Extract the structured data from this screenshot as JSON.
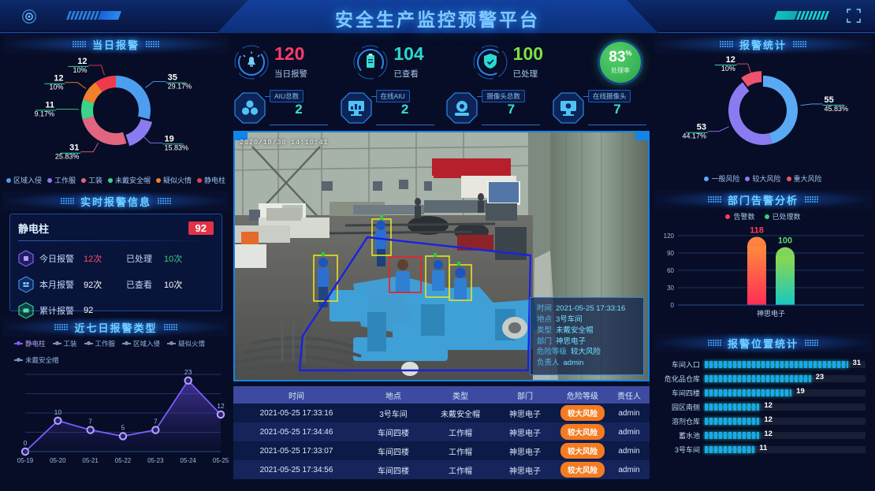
{
  "header": {
    "title": "安全生产监控预警平台",
    "gear_icon": "gear-icon",
    "fullscreen_icon": "fullscreen-icon"
  },
  "left": {
    "daily_alarm": {
      "title": "当日报警",
      "chart_data": {
        "type": "pie",
        "title": "当日报警",
        "categories": [
          "区域入侵",
          "工作服",
          "工装",
          "未戴安全帽",
          "疑似火情",
          "静电柱"
        ],
        "values": [
          35,
          19,
          31,
          11,
          12,
          12
        ],
        "percents": [
          "29.17%",
          "15.83%",
          "25.83%",
          "9.17%",
          "10%",
          "10%"
        ],
        "colors": [
          "#4d9ef0",
          "#8a7bf0",
          "#e2657f",
          "#3cd48a",
          "#f0802e",
          "#ee3b4b"
        ],
        "legend_position": "bottom"
      }
    },
    "realtime": {
      "title": "实时报警信息",
      "name": "静电柱",
      "badge": "92",
      "rows": [
        {
          "icon": "alarm-hex-icon",
          "label": "今日报警",
          "value": "12次",
          "label2": "已处理",
          "value2": "10次"
        },
        {
          "icon": "calendar-hex-icon",
          "label": "本月报警",
          "value": "92次",
          "label2": "已查看",
          "value2": "10次"
        },
        {
          "icon": "total-hex-icon",
          "label": "累计报警",
          "value": "92",
          "label2": "",
          "value2": ""
        }
      ]
    },
    "seven_day": {
      "title": "近七日报警类型",
      "legend": [
        "静电柱",
        "工装",
        "工作服",
        "区域入侵",
        "疑似火情",
        "未戴安全帽"
      ],
      "chart_data": {
        "type": "line",
        "title": "近七日报警类型",
        "categories": [
          "05-19",
          "05-20",
          "05-21",
          "05-22",
          "05-23",
          "05-24",
          "05-25"
        ],
        "series": [
          {
            "name": "静电柱",
            "values": [
              0,
              10,
              7,
              5,
              7,
              23,
              12
            ],
            "color": "#7c5cff"
          }
        ],
        "ylim": [
          0,
          25
        ],
        "grid": true
      }
    }
  },
  "center": {
    "stats": [
      {
        "icon": "alarm-bell-icon",
        "value": "120",
        "label": "当日报警",
        "color": "#ff3b6b"
      },
      {
        "icon": "clipboard-icon",
        "value": "104",
        "label": "已查看",
        "color": "#2ad9d0"
      },
      {
        "icon": "shield-check-icon",
        "value": "100",
        "label": "已处理",
        "color": "#7ee043"
      }
    ],
    "rate": {
      "value": "83",
      "unit": "%",
      "label": "处理率",
      "color": "#3cc45f"
    },
    "devices": [
      {
        "icon": "cube-icon",
        "caption": "AIU总数",
        "value": "2"
      },
      {
        "icon": "monitor-aiu-icon",
        "caption": "在线AIU",
        "value": "2"
      },
      {
        "icon": "camera-icon",
        "caption": "摄像头总数",
        "value": "7"
      },
      {
        "icon": "monitor-camera-icon",
        "caption": "在线摄像头",
        "value": "7"
      }
    ],
    "video": {
      "timestamp": "2020/10/30    14:10:41",
      "overlay": {
        "rows": [
          {
            "key": "时间",
            "value": "2021-05-25 17:33:16"
          },
          {
            "key": "地点",
            "value": "3号车间"
          },
          {
            "key": "类型",
            "value": "未戴安全帽"
          },
          {
            "key": "部门",
            "value": "神思电子"
          },
          {
            "key": "危险等级",
            "value": "较大风险"
          },
          {
            "key": "负责人",
            "value": "admin"
          }
        ]
      }
    },
    "table": {
      "columns": [
        "时间",
        "地点",
        "类型",
        "部门",
        "危险等级",
        "责任人"
      ],
      "rows": [
        {
          "time": "2021-05-25 17:33:16",
          "place": "3号车间",
          "type": "未戴安全帽",
          "dept": "神思电子",
          "risk": "较大风险",
          "owner": "admin"
        },
        {
          "time": "2021-05-25 17:34:46",
          "place": "车间四楼",
          "type": "工作帽",
          "dept": "神思电子",
          "risk": "较大风险",
          "owner": "admin"
        },
        {
          "time": "2021-05-25 17:33:07",
          "place": "车间四楼",
          "type": "工作帽",
          "dept": "神思电子",
          "risk": "较大风险",
          "owner": "admin"
        },
        {
          "time": "2021-05-25 17:34:56",
          "place": "车间四楼",
          "type": "工作帽",
          "dept": "神思电子",
          "risk": "较大风险",
          "owner": "admin"
        }
      ]
    }
  },
  "right": {
    "alarm_stat": {
      "title": "报警统计",
      "chart_data": {
        "type": "pie",
        "title": "报警统计",
        "categories": [
          "一般风险",
          "较大风险",
          "重大风险"
        ],
        "values": [
          55,
          53,
          12
        ],
        "percents": [
          "45.83%",
          "44.17%",
          "10%"
        ],
        "colors": [
          "#5aa9f5",
          "#8a7bf0",
          "#f0526e"
        ],
        "legend_position": "bottom"
      }
    },
    "dept": {
      "title": "部门告警分析",
      "chart_data": {
        "type": "bar",
        "title": "部门告警分析",
        "categories": [
          "神思电子"
        ],
        "series": [
          {
            "name": "告警数",
            "values": [
              118
            ],
            "color": "#ff3b5c"
          },
          {
            "name": "已处理数",
            "values": [
              100
            ],
            "color": "#3ad07f"
          }
        ],
        "ylim": [
          0,
          120
        ],
        "yticks": [
          0,
          30,
          60,
          90,
          120
        ],
        "grid": true
      }
    },
    "locations": {
      "title": "报警位置统计",
      "chart_data": {
        "type": "bar",
        "title": "报警位置统计",
        "orientation": "horizontal",
        "categories": [
          "车间入口",
          "危化品仓库",
          "车间四楼",
          "园区南侧",
          "溶剂仓库",
          "蓄水池",
          "3号车间"
        ],
        "values": [
          31,
          23,
          19,
          12,
          12,
          12,
          11
        ],
        "max": 35
      }
    }
  }
}
